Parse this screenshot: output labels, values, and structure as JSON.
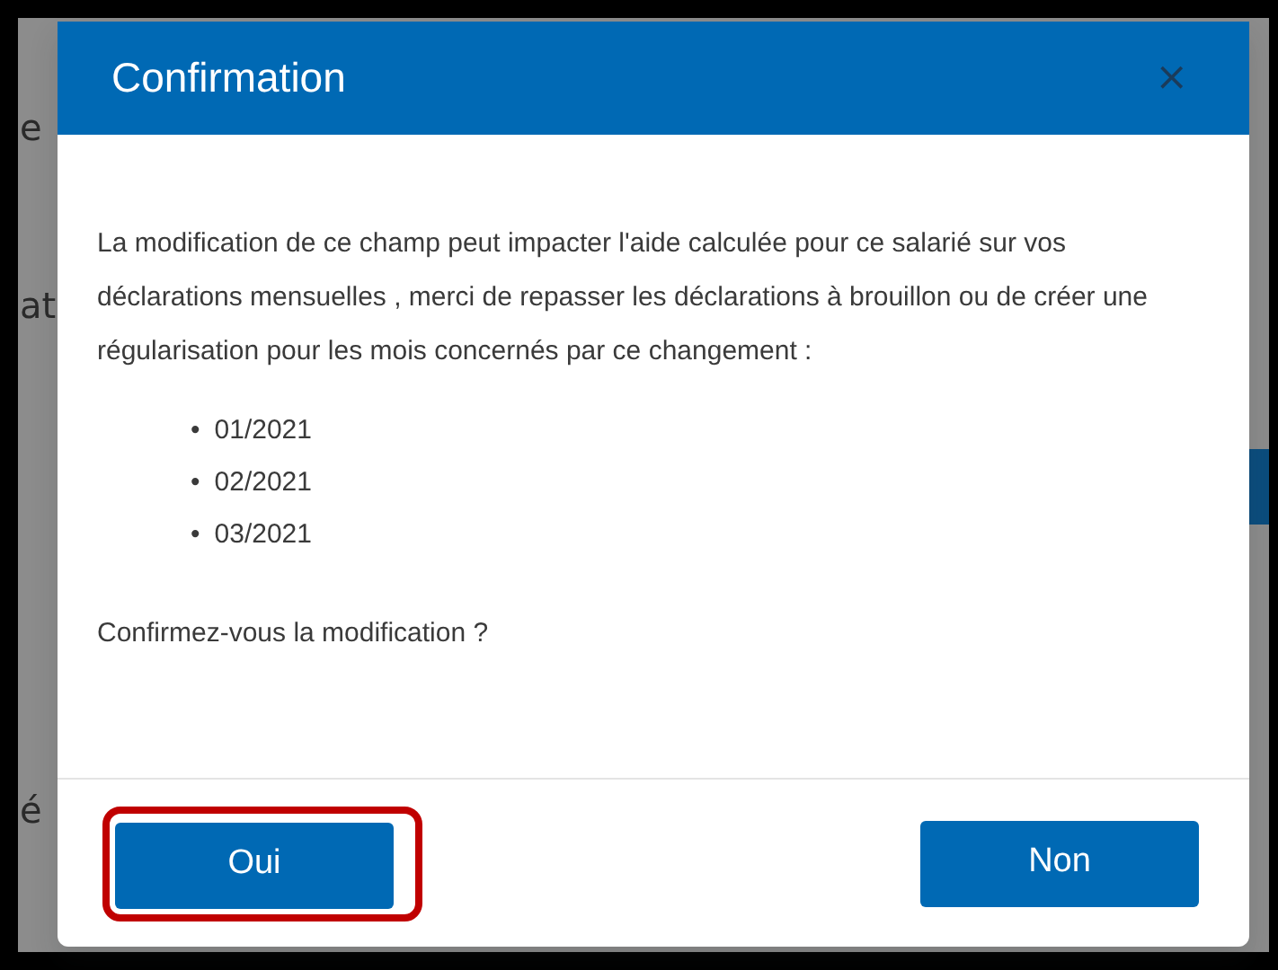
{
  "backdrop": {
    "fragments": [
      "e",
      "at",
      "é"
    ]
  },
  "dialog": {
    "title": "Confirmation",
    "close": "×",
    "message": "La modification de ce champ peut impacter l'aide calculée pour ce salarié sur vos déclarations mensuelles , merci de repasser les déclarations à brouillon ou de créer une régularisation pour les mois concernés par ce changement :",
    "months": [
      {
        "marker": "•",
        "text": "01/2021"
      },
      {
        "marker": "•",
        "text": "02/2021"
      },
      {
        "marker": "•",
        "text": "03/2021"
      }
    ],
    "question": "Confirmez-vous la modification ?",
    "buttons": [
      {
        "label": "Oui",
        "highlighted": true
      },
      {
        "label": "Non",
        "highlighted": false
      }
    ]
  }
}
